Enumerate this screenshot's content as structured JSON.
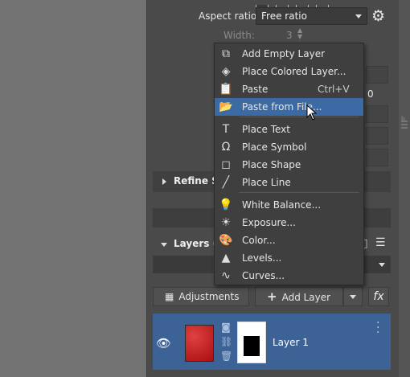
{
  "panel": {
    "aspect_ratio_label": "Aspect ratio:",
    "aspect_ratio_value": "Free ratio",
    "width_label": "Width:",
    "width_value": "3",
    "partial_value": "0"
  },
  "sections": {
    "refine": "Refine S",
    "layers": "Layers ("
  },
  "buttons": {
    "adjustments": "Adjustments",
    "add_layer": "Add Layer",
    "fx": "fx"
  },
  "layer": {
    "name": "Layer 1"
  },
  "menu": {
    "items": [
      {
        "label": "Add Empty Layer",
        "icon": "add-empty-layer-icon",
        "glyph": "⧉",
        "shortcut": ""
      },
      {
        "label": "Place Colored Layer...",
        "icon": "colored-layer-icon",
        "glyph": "◈",
        "shortcut": ""
      },
      {
        "label": "Paste",
        "icon": "paste-icon",
        "glyph": "📋",
        "shortcut": "Ctrl+V"
      },
      {
        "label": "Paste from File...",
        "icon": "paste-from-file-icon",
        "glyph": "📂",
        "shortcut": ""
      },
      {
        "label": "Place Text",
        "icon": "text-icon",
        "glyph": "T",
        "shortcut": ""
      },
      {
        "label": "Place Symbol",
        "icon": "omega-icon",
        "glyph": "Ω",
        "shortcut": ""
      },
      {
        "label": "Place Shape",
        "icon": "shape-icon",
        "glyph": "◻",
        "shortcut": ""
      },
      {
        "label": "Place Line",
        "icon": "line-icon",
        "glyph": "╱",
        "shortcut": ""
      },
      {
        "label": "White Balance...",
        "icon": "bulb-icon",
        "glyph": "💡",
        "shortcut": ""
      },
      {
        "label": "Exposure...",
        "icon": "sun-icon",
        "glyph": "☀",
        "shortcut": ""
      },
      {
        "label": "Color...",
        "icon": "palette-icon",
        "glyph": "🎨",
        "shortcut": ""
      },
      {
        "label": "Levels...",
        "icon": "levels-icon",
        "glyph": "▲",
        "shortcut": ""
      },
      {
        "label": "Curves...",
        "icon": "curves-icon",
        "glyph": "∿",
        "shortcut": ""
      }
    ],
    "highlighted_index": 3
  }
}
